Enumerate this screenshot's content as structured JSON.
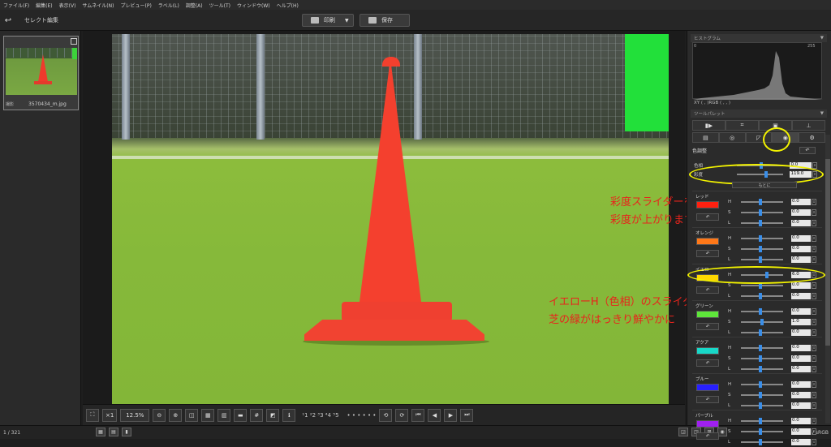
{
  "menubar": [
    "ファイル(F)",
    "編集(E)",
    "表示(V)",
    "サムネイル(N)",
    "プレビュー(P)",
    "ラベル(L)",
    "調整(A)",
    "ツール(T)",
    "ウィンドウ(W)",
    "ヘルプ(H)"
  ],
  "toolbar": {
    "back_icon": "↩",
    "mode_title": "セレクト編集",
    "print_label": "印刷",
    "save_label": "保存"
  },
  "thumbnail": {
    "filename": "3570434_m.jpg",
    "tag": "撮影"
  },
  "viewer_bar": {
    "zoom_label": "×1",
    "zoom_value": "12.5%",
    "rating_dots": "• • • • • •",
    "labels": "¹1 ²2 ³3 ⁴4 ⁵5"
  },
  "status": {
    "counter": "1 / 321",
    "colorspace": "sRGB / sRGB"
  },
  "right_panel": {
    "histogram_title": "ヒストグラム",
    "hist_min": "0",
    "hist_max": "255",
    "xy_readout": "XY (     ,     )RGB (     ,     ,     )",
    "tool_palette_title": "ツールパレット",
    "color_adjust_label": "色調整",
    "reset_icon": "↶",
    "hue_label": "色相",
    "hue_value": "0.0",
    "saturation_label": "彩度",
    "saturation_value": "119.0",
    "menu_label": "もとに",
    "groups": [
      {
        "name": "レッド",
        "color": "#ff2010",
        "h": "0.0",
        "s": "0.0",
        "l": "0.0"
      },
      {
        "name": "オレンジ",
        "color": "#ff7818",
        "h": "0.0",
        "s": "0.0",
        "l": "0.0"
      },
      {
        "name": "イエロー",
        "color": "#ffd800",
        "h": "6.0",
        "s": "0.0",
        "l": "0.0"
      },
      {
        "name": "グリーン",
        "color": "#5ee63a",
        "h": "0.0",
        "s": "1.0",
        "l": "0.0"
      },
      {
        "name": "アクア",
        "color": "#18d8c8",
        "h": "0.0",
        "s": "0.0",
        "l": "0.0"
      },
      {
        "name": "ブルー",
        "color": "#2820ff",
        "h": "0.0",
        "s": "0.0",
        "l": "0.0"
      },
      {
        "name": "パープル",
        "color": "#a020f0",
        "h": "0.0",
        "s": "0.0",
        "l": "0.0"
      }
    ]
  },
  "annotations": {
    "line1": "彩度スライダーを少し右へ",
    "line2": "彩度が上がります",
    "line3": "イエローH（色相）のスライダーを右へ",
    "line4": "芝の緑がはっきり鮮やかに"
  },
  "colors": {
    "annotation": "#e8241c",
    "highlight": "#f2f200",
    "slider_knob": "#3a8ee8"
  }
}
